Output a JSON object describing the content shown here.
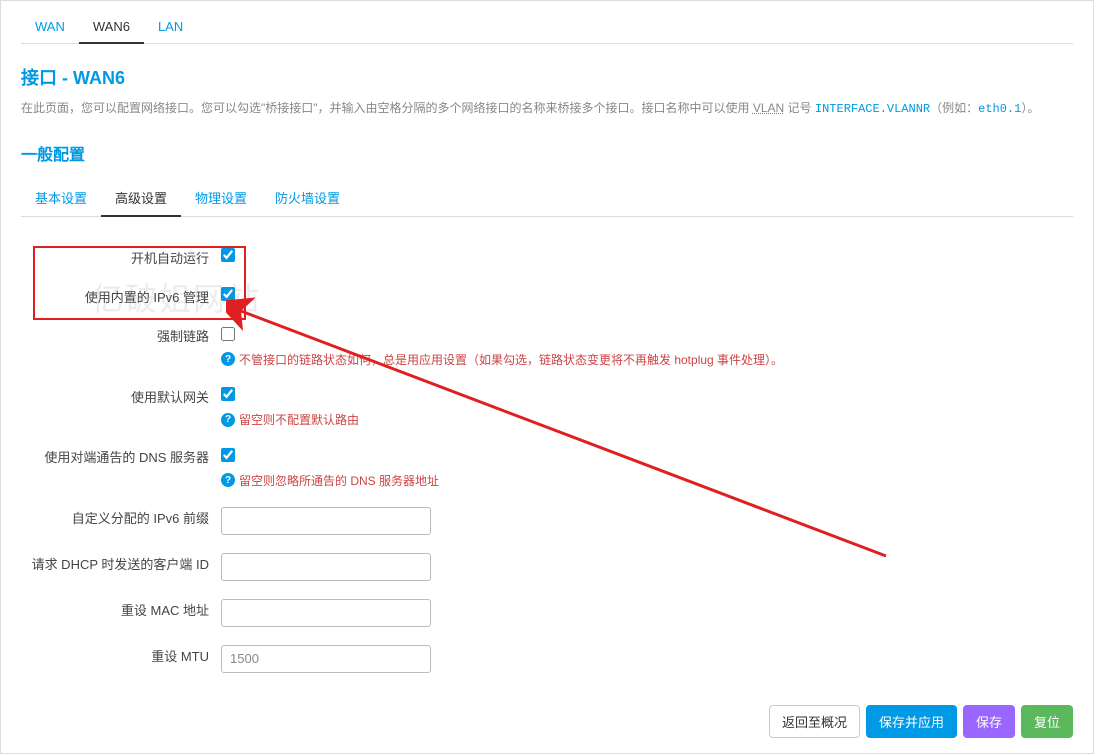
{
  "tabs": {
    "wan": "WAN",
    "wan6": "WAN6",
    "lan": "LAN"
  },
  "page": {
    "title": "接口 - WAN6",
    "desc_part1": "在此页面，您可以配置网络接口。您可以勾选\"桥接接口\"，并输入由空格分隔的多个网络接口的名称来桥接多个接口。接口名称中可以使用 ",
    "vlan": "VLAN",
    "desc_part2": " 记号 ",
    "notation": "INTERFACE.VLANNR",
    "desc_part3": "（例如：",
    "example": "eth0.1",
    "desc_part4": "）。"
  },
  "section": {
    "title": "一般配置"
  },
  "subtabs": {
    "basic": "基本设置",
    "advanced": "高级设置",
    "physical": "物理设置",
    "firewall": "防火墙设置"
  },
  "form": {
    "auto_start": {
      "label": "开机自动运行",
      "checked": true
    },
    "ipv6_mgmt": {
      "label": "使用内置的 IPv6 管理",
      "checked": true
    },
    "force_link": {
      "label": "强制链路",
      "checked": false,
      "help": "不管接口的链路状态如何，总是用应用设置（如果勾选，链路状态变更将不再触发 hotplug 事件处理）。"
    },
    "default_gw": {
      "label": "使用默认网关",
      "checked": true,
      "help": "留空则不配置默认路由"
    },
    "peer_dns": {
      "label": "使用对端通告的 DNS 服务器",
      "checked": true,
      "help": "留空则忽略所通告的 DNS 服务器地址"
    },
    "ipv6_prefix": {
      "label": "自定义分配的 IPv6 前缀",
      "value": ""
    },
    "dhcp_client_id": {
      "label": "请求 DHCP 时发送的客户端 ID",
      "value": ""
    },
    "mac_override": {
      "label": "重设 MAC 地址",
      "value": ""
    },
    "mtu_override": {
      "label": "重设 MTU",
      "value": "1500"
    }
  },
  "watermark": "亿破姐网站",
  "buttons": {
    "back": "返回至概况",
    "save_apply": "保存并应用",
    "save": "保存",
    "reset": "复位"
  }
}
